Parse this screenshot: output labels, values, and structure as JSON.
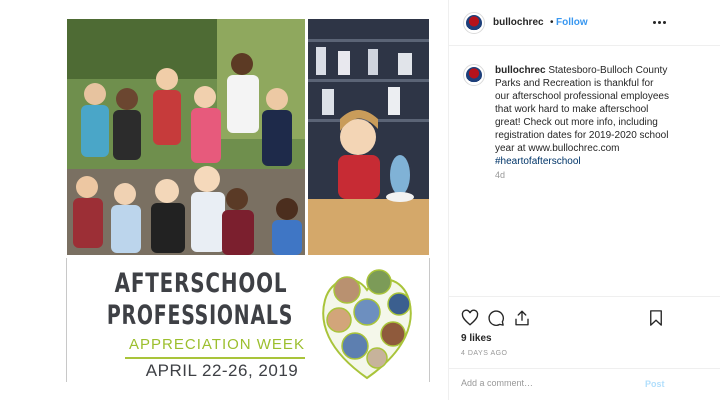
{
  "post": {
    "username": "bullochrec",
    "follow_label": "Follow",
    "separator": "•",
    "caption_user": "bullochrec",
    "caption_text": "Statesboro-Bulloch County Parks and Recreation is thankful for our afterschool professional employees that work hard to make afterschool great! Check out more info, including registration dates for 2019-2020 school year at www.bullochrec.com",
    "caption_hashtag": "#heartofafterschool",
    "relative_time": "4d",
    "likes": "9 likes",
    "date": "4 DAYS AGO",
    "comment_placeholder": "Add a comment…",
    "post_label": "Post"
  },
  "poster": {
    "title_line1": "AFTERSCHOOL",
    "title_line2": "PROFESSIONALS",
    "subtitle": "APPRECIATION WEEK",
    "dates": "APRIL 22-26, 2019"
  },
  "icons": {
    "more": "more-options-icon",
    "like": "heart-icon",
    "comment": "comment-icon",
    "share": "share-icon",
    "save": "bookmark-icon"
  },
  "colors": {
    "follow": "#3897f0",
    "poster_accent": "#9cbf2e",
    "text": "#262626"
  }
}
